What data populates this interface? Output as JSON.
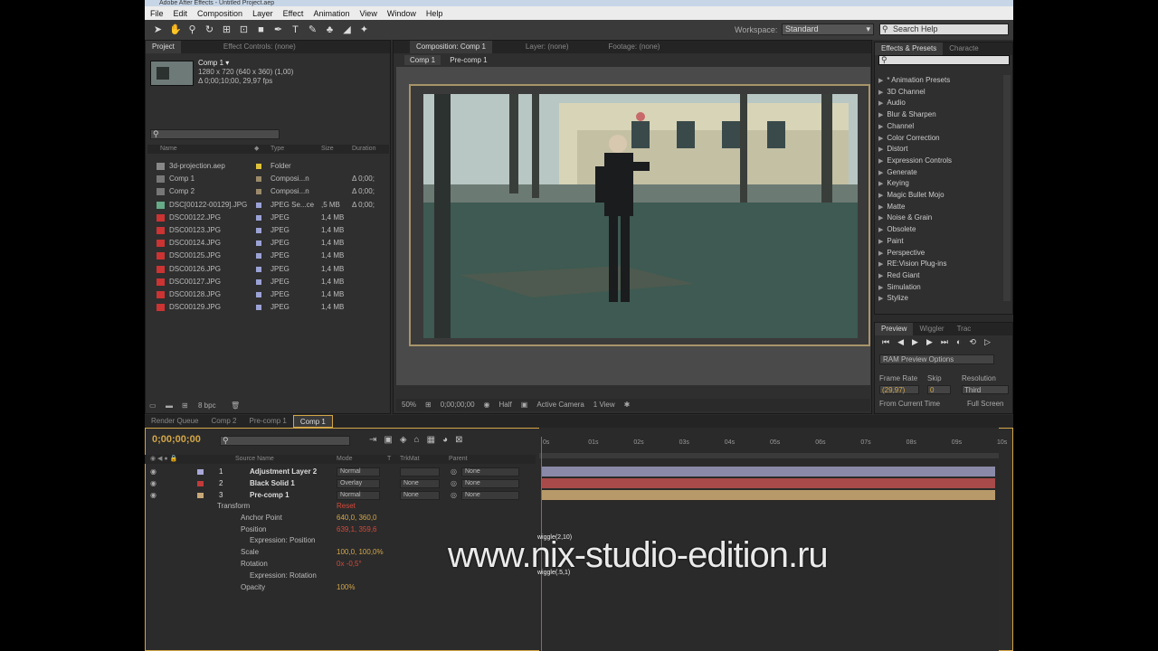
{
  "window_title": "Adobe After Effects - Untitled Project.aep",
  "menu": [
    "File",
    "Edit",
    "Composition",
    "Layer",
    "Effect",
    "Animation",
    "View",
    "Window",
    "Help"
  ],
  "workspace": {
    "label": "Workspace:",
    "value": "Standard"
  },
  "search_help": "Search Help",
  "project_panel": {
    "tabs": [
      "Project",
      "Effect Controls: (none)"
    ],
    "comp_name": "Comp 1 ▾",
    "comp_info": [
      "1280 x 720  (640 x 360) (1,00)",
      "Δ 0;00;10;00, 29,97 fps"
    ],
    "columns": [
      "Name",
      "Type",
      "Size",
      "Duration"
    ],
    "items": [
      {
        "name": "3d-projection.aep",
        "type": "Folder",
        "size": "",
        "duration": "",
        "icon": "folder",
        "label_color": "#e0c23a"
      },
      {
        "name": "Comp 1",
        "type": "Composi...n",
        "size": "",
        "duration": "Δ 0;00;",
        "icon": "comp",
        "label_color": "#9b8a6a"
      },
      {
        "name": "Comp 2",
        "type": "Composi...n",
        "size": "",
        "duration": "Δ 0;00;",
        "icon": "comp",
        "label_color": "#9b8a6a"
      },
      {
        "name": "DSC[00122-00129].JPG",
        "type": "JPEG Se...ce",
        "size": ",5 MB",
        "duration": "Δ 0;00;",
        "icon": "sequence",
        "label_color": "#9ba3d6"
      },
      {
        "name": "DSC00122.JPG",
        "type": "JPEG",
        "size": "1,4 MB",
        "duration": "",
        "icon": "image",
        "label_color": "#9ba3d6"
      },
      {
        "name": "DSC00123.JPG",
        "type": "JPEG",
        "size": "1,4 MB",
        "duration": "",
        "icon": "image",
        "label_color": "#9ba3d6"
      },
      {
        "name": "DSC00124.JPG",
        "type": "JPEG",
        "size": "1,4 MB",
        "duration": "",
        "icon": "image",
        "label_color": "#9ba3d6"
      },
      {
        "name": "DSC00125.JPG",
        "type": "JPEG",
        "size": "1,4 MB",
        "duration": "",
        "icon": "image",
        "label_color": "#9ba3d6"
      },
      {
        "name": "DSC00126.JPG",
        "type": "JPEG",
        "size": "1,4 MB",
        "duration": "",
        "icon": "image",
        "label_color": "#9ba3d6"
      },
      {
        "name": "DSC00127.JPG",
        "type": "JPEG",
        "size": "1,4 MB",
        "duration": "",
        "icon": "image",
        "label_color": "#9ba3d6"
      },
      {
        "name": "DSC00128.JPG",
        "type": "JPEG",
        "size": "1,4 MB",
        "duration": "",
        "icon": "image",
        "label_color": "#9ba3d6"
      },
      {
        "name": "DSC00129.JPG",
        "type": "JPEG",
        "size": "1,4 MB",
        "duration": "",
        "icon": "image",
        "label_color": "#9ba3d6"
      }
    ],
    "bpc": "8 bpc"
  },
  "comp_panel": {
    "tabs": [
      "Composition: Comp 1",
      "Layer: (none)",
      "Footage: (none)"
    ],
    "breadcrumbs": [
      "Comp 1",
      "Pre-comp 1"
    ],
    "zoom": "50%",
    "timecode": "0;00;00;00",
    "resolution": "Half",
    "camera": "Active Camera",
    "view": "1 View"
  },
  "effects_panel": {
    "tabs": [
      "Effects & Presets",
      "Characte"
    ],
    "items": [
      "* Animation Presets",
      "3D Channel",
      "Audio",
      "Blur & Sharpen",
      "Channel",
      "Color Correction",
      "Distort",
      "Expression Controls",
      "Generate",
      "Keying",
      "Magic Bullet Mojo",
      "Matte",
      "Noise & Grain",
      "Obsolete",
      "Paint",
      "Perspective",
      "RE:Vision Plug-ins",
      "Red Giant",
      "Simulation",
      "Stylize"
    ]
  },
  "preview_panel": {
    "tabs": [
      "Preview",
      "Wiggler",
      "Trac"
    ],
    "ram_options": "RAM Preview Options",
    "frame_rate_label": "Frame Rate",
    "skip_label": "Skip",
    "resolution_label": "Resolution",
    "frame_rate": "(29,97)",
    "skip": "0",
    "resolution": "Third",
    "from_current": "From Current Time",
    "full_screen": "Full Screen"
  },
  "timeline": {
    "tabs": [
      "Render Queue",
      "Comp 2",
      "Pre-comp 1",
      "Comp 1"
    ],
    "timecode": "0;00;00;00",
    "columns": [
      "Source Name",
      "Mode",
      "T",
      "TrkMat",
      "Parent"
    ],
    "ruler": [
      "0s",
      "01s",
      "02s",
      "03s",
      "04s",
      "05s",
      "06s",
      "07s",
      "08s",
      "09s",
      "10s"
    ],
    "layers": [
      {
        "num": "1",
        "name": "Adjustment Layer 2",
        "mode": "Normal",
        "trkmat": "",
        "parent": "None",
        "label": "#a8a8d8",
        "bar": "#8a8aa8"
      },
      {
        "num": "2",
        "name": "Black Solid 1",
        "mode": "Overlay",
        "trkmat": "None",
        "parent": "None",
        "label": "#c23a3a",
        "bar": "#a84a4a"
      },
      {
        "num": "3",
        "name": "Pre-comp 1",
        "mode": "Normal",
        "trkmat": "None",
        "parent": "None",
        "label": "#c8a878",
        "bar": "#b89a6a"
      }
    ],
    "props": [
      {
        "name": "Transform",
        "value": "Reset"
      },
      {
        "name": "Anchor Point",
        "value": "640,0, 360,0"
      },
      {
        "name": "Position",
        "value": "639,1, 359,6"
      },
      {
        "name": "Expression: Position",
        "value": ""
      },
      {
        "name": "Scale",
        "value": "100,0, 100,0%"
      },
      {
        "name": "Rotation",
        "value": "0x -0,5°"
      },
      {
        "name": "Expression: Rotation",
        "value": ""
      },
      {
        "name": "Opacity",
        "value": "100%"
      }
    ],
    "expr_position": "wiggle(2,10)",
    "expr_rotation": "wiggle(.5,1)"
  },
  "watermark": "www.nix-studio-edition.ru"
}
